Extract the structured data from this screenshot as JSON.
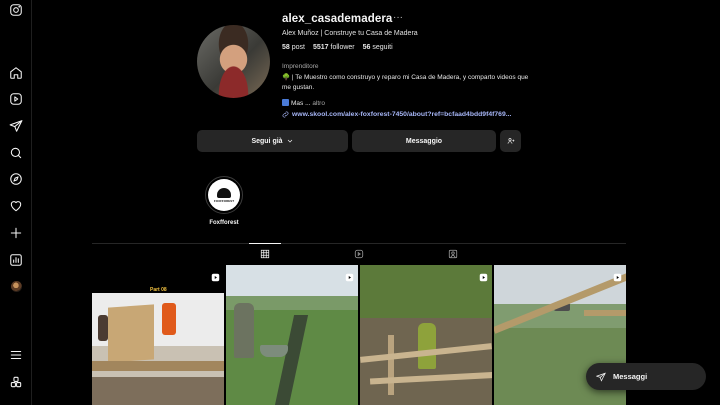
{
  "profile": {
    "username": "alex_casademadera",
    "more": "···",
    "full_name": "Alex Muñoz | Construye tu Casa de Madera",
    "stats": {
      "posts_count": "58",
      "posts_label": "post",
      "followers_count": "5517",
      "followers_label": "follower",
      "following_count": "56",
      "following_label": "seguiti"
    },
    "category": "Imprenditore",
    "bio": "🌳 | Te Muestro como construyo y reparo mi Casa de Madera, y comparto videos que me gustan.",
    "bio_more": "Mas ... ",
    "bio_more_link": "altro",
    "link": "www.skool.com/alex-foxforest-7450/about?ref=bcfaad4bdd9f4f769..."
  },
  "actions": {
    "follow_label": "Segui già",
    "message_label": "Messaggio"
  },
  "highlights": [
    {
      "label": "Foxfforest",
      "logo_text": "FOXFFOREST"
    }
  ],
  "grid": {
    "posts": [
      {
        "overlay_text": "Part 08",
        "type": "reel"
      },
      {
        "type": "reel"
      },
      {
        "type": "reel"
      },
      {
        "type": "reel"
      }
    ]
  },
  "messages": {
    "label": "Messaggi"
  },
  "icons": {
    "sidebar": [
      "instagram-icon",
      "home-icon",
      "reels-icon",
      "send-icon",
      "search-icon",
      "explore-icon",
      "heart-icon",
      "create-icon",
      "dashboard-icon",
      "profile-avatar",
      "menu-icon",
      "threads-icon"
    ]
  }
}
